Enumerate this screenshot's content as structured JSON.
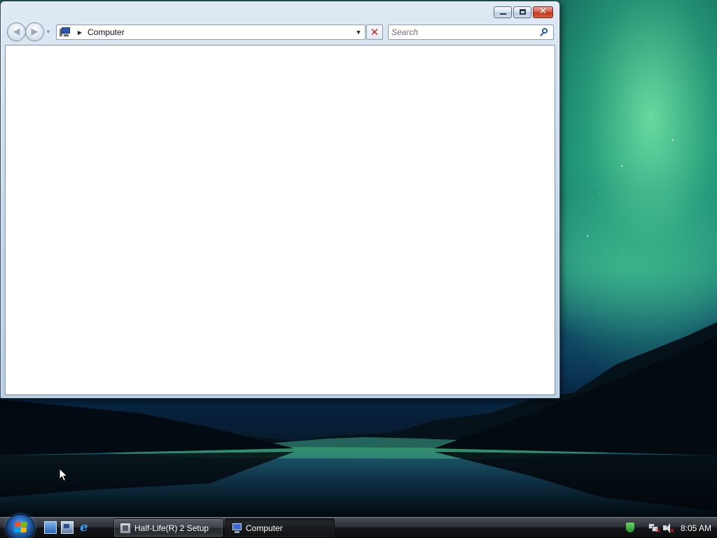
{
  "window": {
    "address": {
      "location": "Computer",
      "icon": "computer-icon"
    },
    "search": {
      "placeholder": "Search",
      "value": ""
    },
    "caption_buttons": [
      "minimize",
      "maximize",
      "close"
    ],
    "caption_glyphs": {
      "close": "✕"
    },
    "nav_glyphs": {
      "back": "◀",
      "forward": "▶",
      "recent_dropdown": "▼",
      "address_separator": "▶",
      "address_dropdown": "▼",
      "stop": "✕"
    }
  },
  "taskbar": {
    "start_icon": "windows-flag-icon",
    "quick_launch": [
      {
        "name": "show-desktop",
        "icon": "desktop-icon"
      },
      {
        "name": "switch-windows",
        "icon": "switch-windows-icon"
      },
      {
        "name": "internet-explorer",
        "icon": "ie-icon",
        "glyph": "e"
      }
    ],
    "tasks": [
      {
        "label": "Half-Life(R) 2 Setup",
        "icon": "setup-icon",
        "active": false
      },
      {
        "label": "Computer",
        "icon": "computer-icon",
        "active": true
      }
    ],
    "tray": {
      "icons": [
        "security-shield-icon",
        "network-disconnected-icon",
        "volume-muted-icon"
      ],
      "overlay_glyph": "✕",
      "clock": "8:05 AM"
    }
  },
  "colors": {
    "taskbar": "#1b1d21",
    "window_frame": "#c3d6e8",
    "close_button": "#c1341c",
    "aurora": "#5fd69a"
  }
}
